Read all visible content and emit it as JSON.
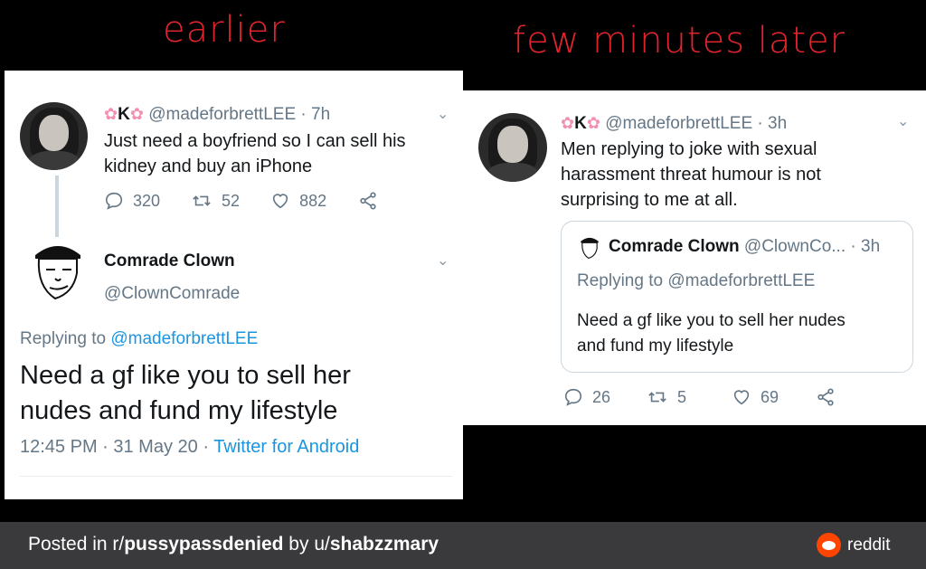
{
  "captions": {
    "left": "earlier",
    "right": "few minutes later"
  },
  "left_card": {
    "tweet1": {
      "name": "K",
      "handle_time": "@madeforbrettLEE · 7h",
      "text_line1": "Just need a boyfriend so I can sell his",
      "text_line2": "kidney and buy an iPhone",
      "replies": "320",
      "retweets": "52",
      "likes": "882"
    },
    "reply": {
      "name": "Comrade Clown",
      "handle": "@ClownComrade",
      "replying_prefix": "Replying to",
      "replying_handle": "@madeforbrettLEE",
      "text_line1": "Need a gf like you to sell her",
      "text_line2": "nudes and fund my lifestyle",
      "timestamp": "12:45 PM · 31 May 20 ·",
      "source": "Twitter for Android"
    }
  },
  "right_card": {
    "tweet": {
      "name": "K",
      "handle_time": "@madeforbrettLEE · 3h",
      "text_line1": "Men replying to joke with sexual",
      "text_line2": "harassment threat humour is not",
      "text_line3": "surprising to me at all.",
      "replies": "26",
      "retweets": "5",
      "likes": "69"
    },
    "quote": {
      "name": "Comrade Clown",
      "handle_time": "@ClownCo... · 3h",
      "replying": "Replying to @madeforbrettLEE",
      "text_line1": "Need a gf like you to sell her nudes",
      "text_line2": "and fund my lifestyle"
    }
  },
  "footer": {
    "prefix": "Posted in r/",
    "subreddit": "pussypassdenied",
    "by": " by u/",
    "user": "shabzzmary",
    "brand": "reddit"
  },
  "colors": {
    "caption": "#e0242e",
    "link": "#1b95e0",
    "footer_bg": "#3a3a3c",
    "reddit": "#ff4500"
  }
}
